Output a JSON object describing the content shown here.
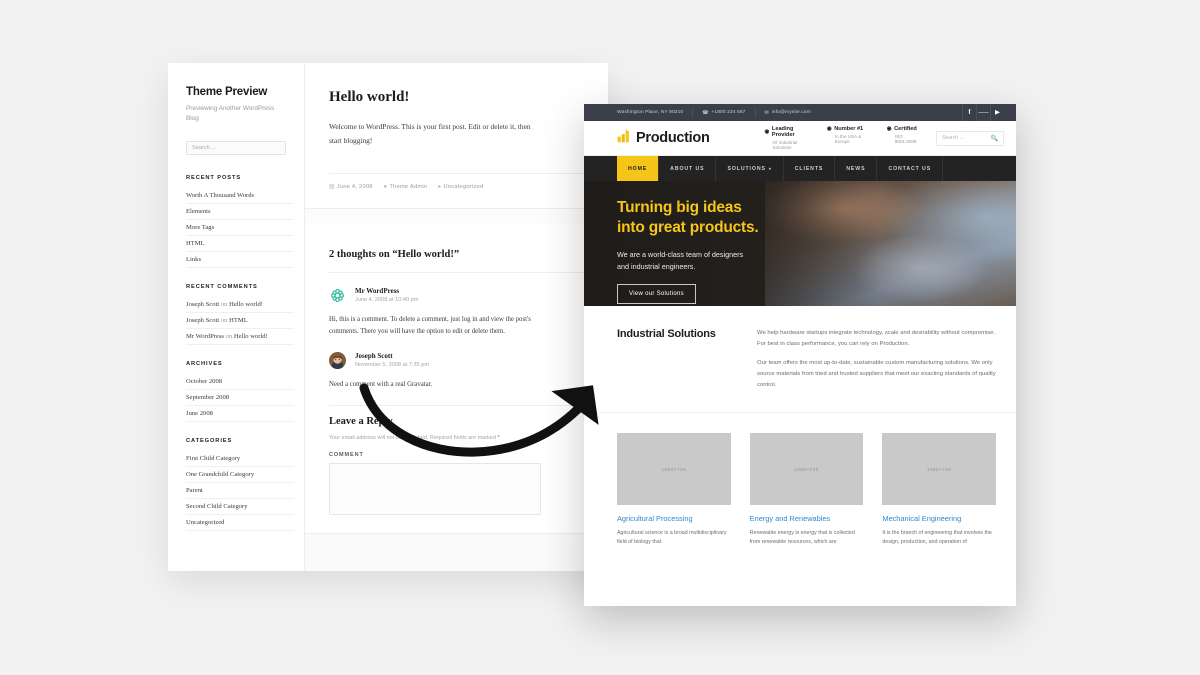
{
  "background_color": "#f2f2f2",
  "wordpress_preview": {
    "sidebar": {
      "site_title": "Theme Preview",
      "site_description": "Previewing Another WordPress Blog",
      "search_placeholder": "Search …",
      "widgets": [
        {
          "title": "RECENT POSTS",
          "items": [
            "Worth A Thousand Words",
            "Elements",
            "More Tags",
            "HTML",
            "Links"
          ]
        },
        {
          "title": "RECENT COMMENTS",
          "items": [
            {
              "author": "Joseph Scott",
              "on": "on",
              "target": "Hello world!"
            },
            {
              "author": "Joseph Scott",
              "on": "on",
              "target": "HTML"
            },
            {
              "author": "Mr WordPress",
              "on": "on",
              "target": "Hello world!"
            }
          ]
        },
        {
          "title": "ARCHIVES",
          "items": [
            "October 2008",
            "September 2008",
            "June 2008"
          ]
        },
        {
          "title": "CATEGORIES",
          "items": [
            "First Child Category",
            "One Grandchild Category",
            "Parent",
            "Second Child Category",
            "Uncategorized"
          ]
        }
      ]
    },
    "post": {
      "title": "Hello world!",
      "body": "Welcome to WordPress. This is your first post. Edit or delete it, then start blogging!",
      "meta": {
        "date": "June 4, 2008",
        "author": "Theme Admin",
        "category": "Uncategorized"
      }
    },
    "comments": {
      "heading": "2 thoughts on “Hello world!”",
      "list": [
        {
          "author": "Mr WordPress",
          "date": "June 4, 2008 at 10:40 pm",
          "text": "Hi, this is a comment. To delete a comment, just log in and view the post's comments. There you will have the option to edit or delete them."
        },
        {
          "author": "Joseph Scott",
          "date": "November 5, 2008 at 7:35 pm",
          "text": "Need a comment with a real Gravatar."
        }
      ]
    },
    "reply": {
      "heading": "Leave a Reply",
      "note": "Your email address will not be published. Required fields are marked",
      "required_mark": "*",
      "comment_label": "COMMENT"
    }
  },
  "production_site": {
    "topbar": {
      "address": "Washington Place, NY 90210",
      "phone": "+1800 234 567",
      "email": "info@mysite.com",
      "social": [
        "f",
        "t",
        "y"
      ]
    },
    "header": {
      "brand": "Production",
      "logo_icon": "factory-icon",
      "features": [
        {
          "title": "Leading Provider",
          "subtitle": "Of Industrial Solutions"
        },
        {
          "title": "Number #1",
          "subtitle": "In the USA & Europe"
        },
        {
          "title": "Certified",
          "subtitle": "ISO 9001:2008"
        }
      ],
      "search_placeholder": "Search …"
    },
    "nav": [
      {
        "label": "HOME",
        "active": true,
        "caret": false
      },
      {
        "label": "ABOUT US",
        "active": false,
        "caret": false
      },
      {
        "label": "SOLUTIONS",
        "active": false,
        "caret": true
      },
      {
        "label": "CLIENTS",
        "active": false,
        "caret": false
      },
      {
        "label": "NEWS",
        "active": false,
        "caret": false
      },
      {
        "label": "CONTACT US",
        "active": false,
        "caret": false
      }
    ],
    "hero": {
      "headline_line1": "Turning big ideas",
      "headline_line2": "into great products.",
      "subtext_line1": "We are a world-class team of designers",
      "subtext_line2": "and industrial engineers.",
      "button": "View our Solutions",
      "headline_color": "#f5c518"
    },
    "intro": {
      "title": "Industrial Solutions",
      "paragraph1": "We help hardware startups integrate technology, scale and desirability without compromise. For best in class performance, you can rely on Production.",
      "paragraph2": "Our team offers the most up-to-date, sustainable custom manufacturing solutions. We only source materials from tried and trusted suppliers that meet our exacting standards of quality control."
    },
    "cards": [
      {
        "image_label": "1080×720",
        "title": "Agricultural Processing",
        "text": "Agricultural science is a broad multidisciplinary field of biology that"
      },
      {
        "image_label": "1080×720",
        "title": "Energy and Renewables",
        "text": "Renewable energy is energy that is collected from renewable resources, which are"
      },
      {
        "image_label": "1080×720",
        "title": "Mechanical Engineering",
        "text": "It is the branch of engineering that involves the design, production, and operation of"
      }
    ],
    "accent_color": "#f5c518",
    "link_color": "#2f89d4"
  },
  "annotation": {
    "arrow": "curved-arrow-pointing-to-production-site"
  }
}
